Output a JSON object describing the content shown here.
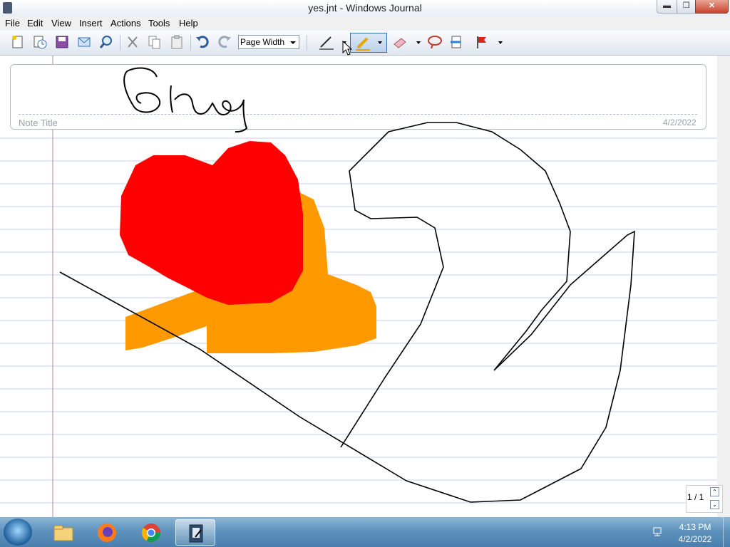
{
  "window": {
    "title": "yes.jnt - Windows Journal"
  },
  "window_controls": {
    "minimize": "▬",
    "maximize": "❐",
    "close": "✕"
  },
  "menu": [
    "File",
    "Edit",
    "View",
    "Insert",
    "Actions",
    "Tools",
    "Help"
  ],
  "toolbar": {
    "zoom_value": "Page Width",
    "icons": [
      "new-note-icon",
      "open-recent-icon",
      "save-icon",
      "send-email-icon",
      "find-icon",
      "pen-cut-icon",
      "copy-icon",
      "paste-icon",
      "undo-icon",
      "redo-icon"
    ],
    "pen_tools": [
      "pen-icon",
      "highlighter-icon",
      "eraser-icon",
      "lasso-select-icon",
      "insert-space-icon",
      "flag-icon"
    ]
  },
  "note": {
    "title_handwriting": "Bruy",
    "title_placeholder": "Note Title",
    "date": "4/2/2022"
  },
  "pager": {
    "page_label": "1 / 1",
    "up": "⌃",
    "down": "⌄"
  },
  "taskbar": {
    "apps": [
      "Windows Explorer",
      "Firefox",
      "Chrome",
      "Windows Journal"
    ],
    "time": "4:13 PM",
    "date": "4/2/2022"
  },
  "colors": {
    "ink": "#000000",
    "highlight_orange": "#ff9900",
    "red_fill": "#ff0000",
    "rule_line": "#c8d0e6",
    "margin_line": "#b38bb5"
  }
}
